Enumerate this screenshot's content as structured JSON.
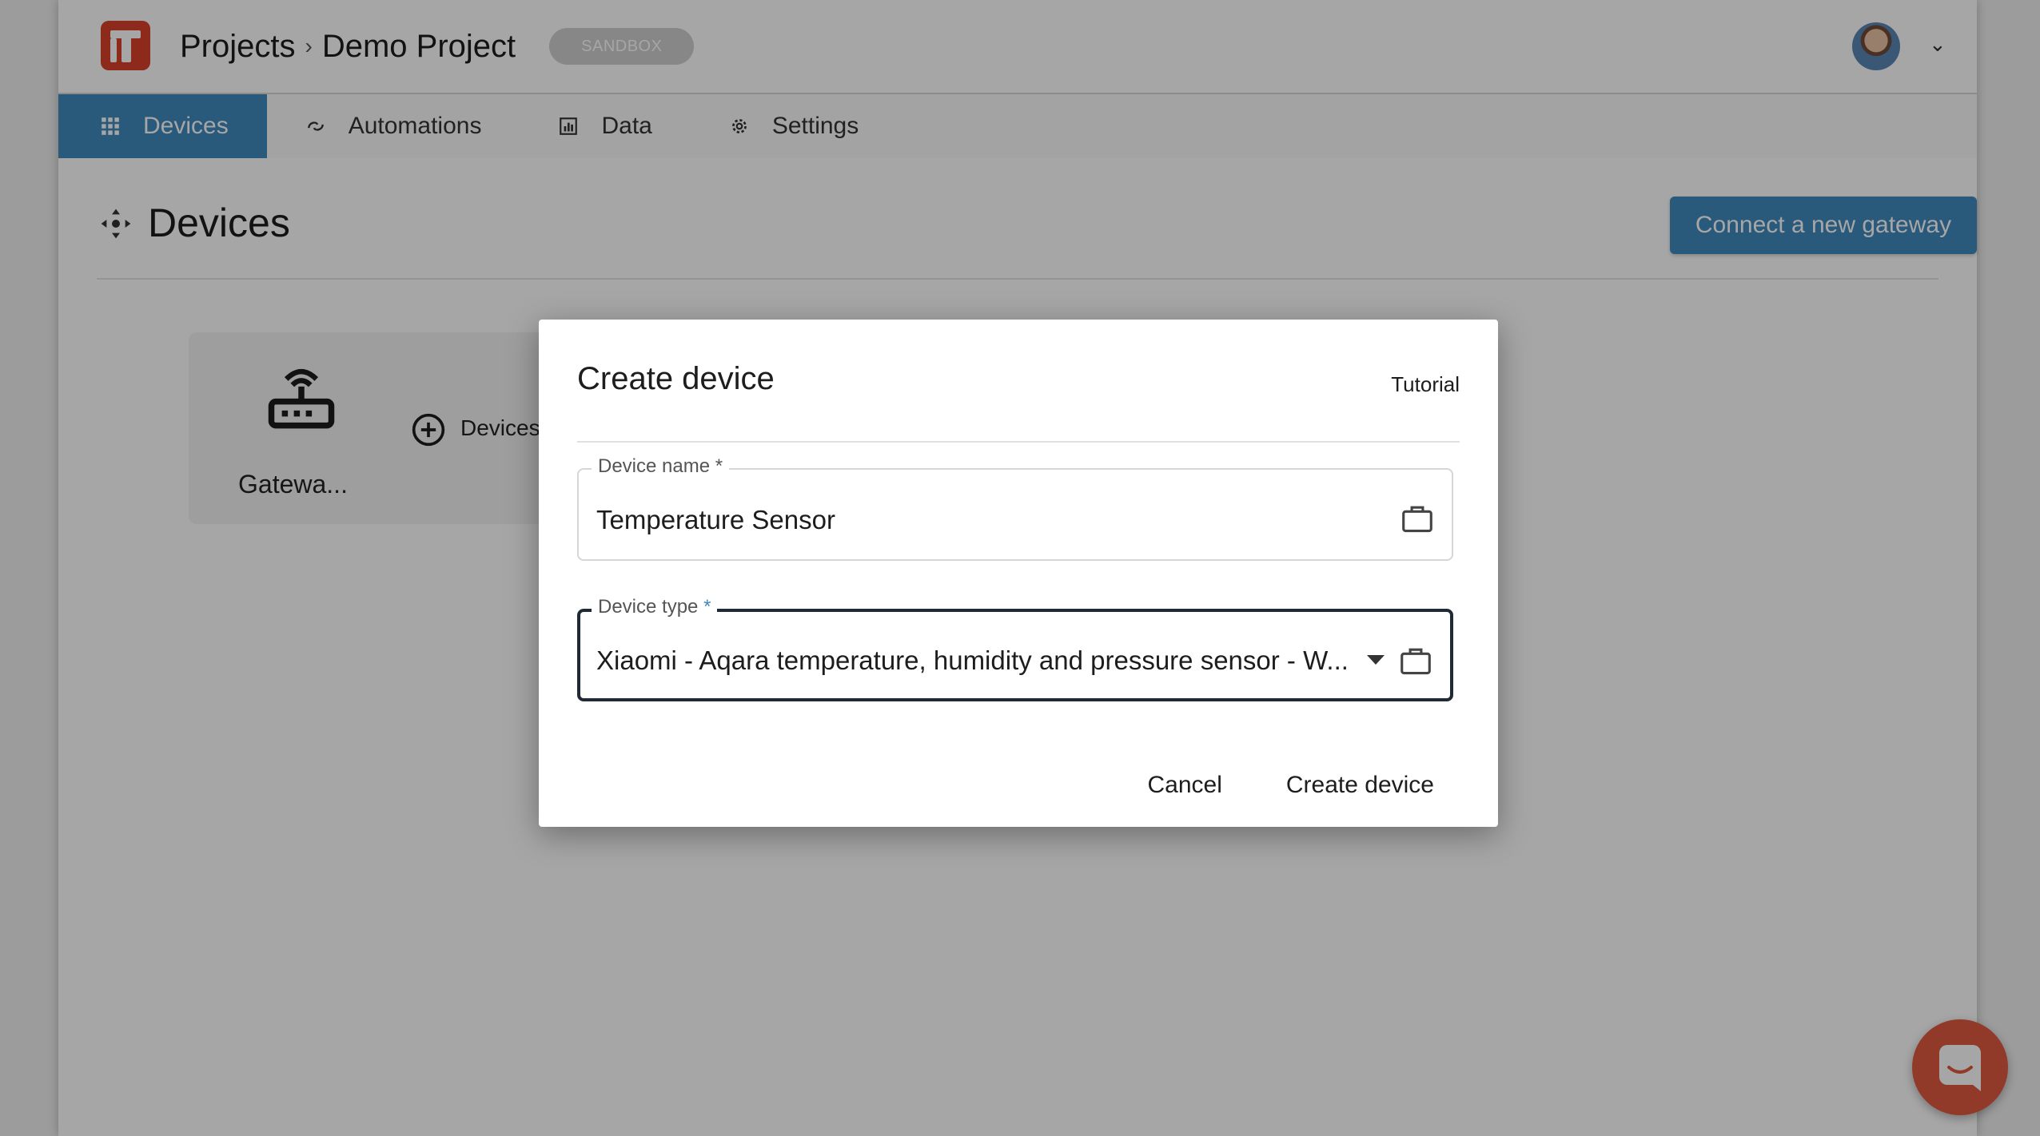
{
  "header": {
    "breadcrumb": [
      "Projects",
      "Demo Project"
    ],
    "breadcrumb_separator": "›",
    "environment_badge": "SANDBOX",
    "avatar_icon": "user-avatar",
    "menu_caret": "⌄"
  },
  "tabs": [
    {
      "label": "Devices",
      "icon": "grid-icon",
      "active": true
    },
    {
      "label": "Automations",
      "icon": "link-icon",
      "active": false
    },
    {
      "label": "Data",
      "icon": "chart-icon",
      "active": false
    },
    {
      "label": "Settings",
      "icon": "gear-icon",
      "active": false
    }
  ],
  "page": {
    "title": "Devices",
    "primary_action": "Connect a new gateway"
  },
  "gateway_card": {
    "label": "Gatewa...",
    "add_label": "Devices"
  },
  "dialog": {
    "title": "Create device",
    "tutorial_link": "Tutorial",
    "name_field": {
      "label": "Device name",
      "required_marker": "*",
      "value": "Temperature Sensor"
    },
    "type_field": {
      "label": "Device type",
      "required_marker": "*",
      "value": "Xiaomi - Aqara temperature, humidity and pressure sensor - W..."
    },
    "cancel_label": "Cancel",
    "submit_label": "Create device"
  },
  "colors": {
    "brand_red": "#d9412b",
    "accent_blue": "#3f89be",
    "chat_orange": "#e05a40"
  }
}
